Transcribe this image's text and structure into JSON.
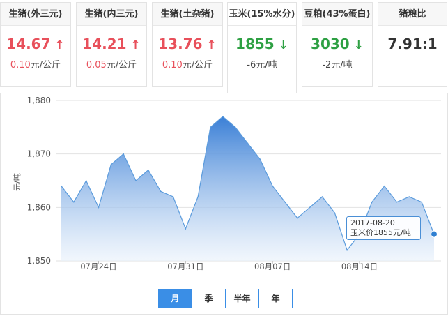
{
  "cards": [
    {
      "title": "生猪(外三元)",
      "value": "14.67",
      "arrow": "↑",
      "direction": "up",
      "change": "0.10",
      "unit": "元/公斤"
    },
    {
      "title": "生猪(内三元)",
      "value": "14.21",
      "arrow": "↑",
      "direction": "up",
      "change": "0.05",
      "unit": "元/公斤"
    },
    {
      "title": "生猪(土杂猪)",
      "value": "13.76",
      "arrow": "↑",
      "direction": "up",
      "change": "0.10",
      "unit": "元/公斤"
    },
    {
      "title": "玉米(15%水分)",
      "value": "1855",
      "arrow": "↓",
      "direction": "down",
      "change": "-6",
      "unit": "元/吨"
    },
    {
      "title": "豆粕(43%蛋白)",
      "value": "3030",
      "arrow": "↓",
      "direction": "down",
      "change": "-2",
      "unit": "元/吨"
    },
    {
      "title": "猪粮比",
      "value": "7.91:1",
      "arrow": "",
      "direction": "flat",
      "change": "",
      "unit": ""
    }
  ],
  "colors": {
    "up": "#e8505b",
    "down": "#2ea043",
    "accent": "#3a8ee6",
    "line": "#5b9bdc"
  },
  "tooltip": {
    "date": "2017-08-20",
    "text": "玉米价1855元/吨"
  },
  "range_tabs": [
    {
      "label": "月",
      "selected": true
    },
    {
      "label": "季",
      "selected": false
    },
    {
      "label": "半年",
      "selected": false
    },
    {
      "label": "年",
      "selected": false
    }
  ],
  "chart_data": {
    "type": "area",
    "title": "",
    "xlabel": "",
    "ylabel": "元/吨",
    "ylim": [
      1850,
      1880
    ],
    "yticks": [
      1850,
      1860,
      1870,
      1880
    ],
    "ytick_labels": [
      "1,850",
      "1,860",
      "1,870",
      "1,880"
    ],
    "x": [
      "2017-07-21",
      "2017-07-22",
      "2017-07-23",
      "2017-07-24",
      "2017-07-25",
      "2017-07-26",
      "2017-07-27",
      "2017-07-28",
      "2017-07-29",
      "2017-07-30",
      "2017-07-31",
      "2017-08-01",
      "2017-08-02",
      "2017-08-03",
      "2017-08-04",
      "2017-08-05",
      "2017-08-06",
      "2017-08-07",
      "2017-08-08",
      "2017-08-09",
      "2017-08-10",
      "2017-08-11",
      "2017-08-12",
      "2017-08-13",
      "2017-08-14",
      "2017-08-15",
      "2017-08-16",
      "2017-08-17",
      "2017-08-18",
      "2017-08-19",
      "2017-08-20"
    ],
    "xtick_labels": [
      {
        "index": 3,
        "label": "07月24日"
      },
      {
        "index": 10,
        "label": "07月31日"
      },
      {
        "index": 17,
        "label": "08月07日"
      },
      {
        "index": 24,
        "label": "08月14日"
      }
    ],
    "series": [
      {
        "values": [
          1864,
          1861,
          1865,
          1860,
          1868,
          1870,
          1865,
          1867,
          1863,
          1862,
          1856,
          1862,
          1875,
          1877,
          1875,
          1872,
          1869,
          1864,
          1861,
          1858,
          1860,
          1862,
          1859,
          1852,
          1855,
          1861,
          1864,
          1861,
          1862,
          1861,
          1855
        ]
      }
    ],
    "grid": true,
    "highlight_index": 30
  }
}
